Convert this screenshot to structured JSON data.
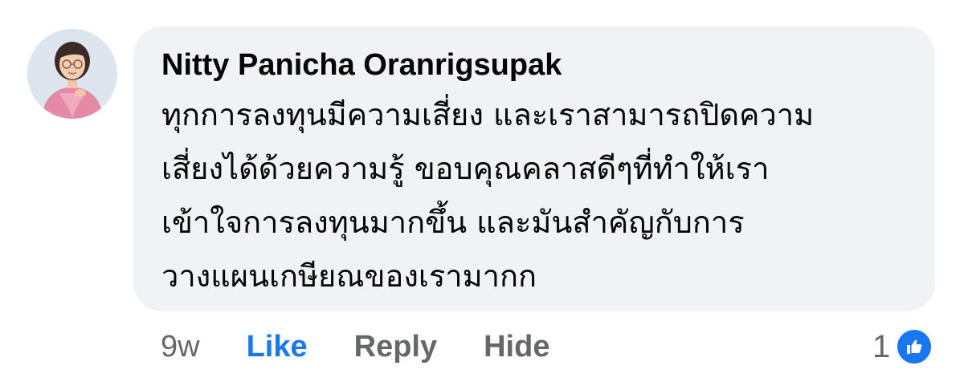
{
  "comment": {
    "author": "Nitty Panicha Oranrigsupak",
    "text_lines": [
      "ทุกการลงทุนมีความเสี่ยง และเราสามารถปิดความ",
      "เสี่ยงได้ด้วยความรู้ ขอบคุณคลาสดีๆที่ทำให้เรา",
      "เข้าใจการลงทุนมากขึ้น และมันสำคัญกับการ",
      "วางแผนเกษียณของเรามากก"
    ],
    "timestamp": "9w",
    "actions": {
      "like": "Like",
      "reply": "Reply",
      "hide": "Hide"
    },
    "reaction_count": "1",
    "reaction_icon": "thumbs-up-icon"
  },
  "colors": {
    "bubble_bg": "#f0f2f5",
    "text": "#050505",
    "muted": "#65676b",
    "accent": "#1877f2"
  }
}
